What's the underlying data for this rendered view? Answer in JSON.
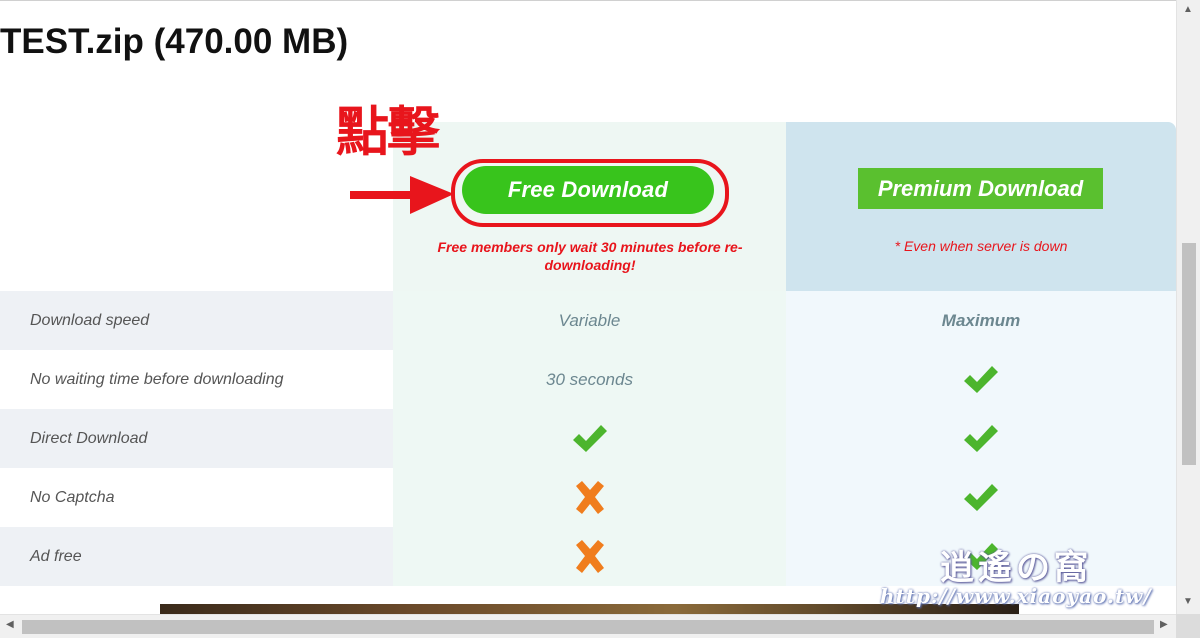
{
  "file": {
    "title": "TEST.zip (470.00 MB)"
  },
  "annotation": {
    "text": "點擊"
  },
  "free": {
    "button_label": "Free Download",
    "note": "Free members only wait 30 minutes before re-downloading!"
  },
  "premium": {
    "button_label": "Premium Download",
    "note": "* Even when server is down"
  },
  "comparison": {
    "rows": [
      {
        "label": "Download speed",
        "free": "Variable",
        "premium": "Maximum"
      },
      {
        "label": "No waiting time before downloading",
        "free": "30 seconds",
        "premium": "check-icon"
      },
      {
        "label": "Direct Download",
        "free": "check-icon",
        "premium": "check-icon"
      },
      {
        "label": "No Captcha",
        "free": "cross-icon",
        "premium": "check-icon"
      },
      {
        "label": "Ad free",
        "free": "cross-icon",
        "premium": "check-icon"
      }
    ]
  },
  "watermark": {
    "cjk": "逍遙の窩",
    "url": "http://www.xiaoyao.tw/"
  },
  "colors": {
    "free_button": "#38c41c",
    "premium_button": "#5ac02f",
    "annotation_red": "#e8151c",
    "check_green": "#4cb52d",
    "cross_orange": "#f07d1d"
  },
  "icons": {
    "scroll_up": "▲",
    "scroll_down": "▼",
    "scroll_left": "◀",
    "scroll_right": "▶"
  }
}
